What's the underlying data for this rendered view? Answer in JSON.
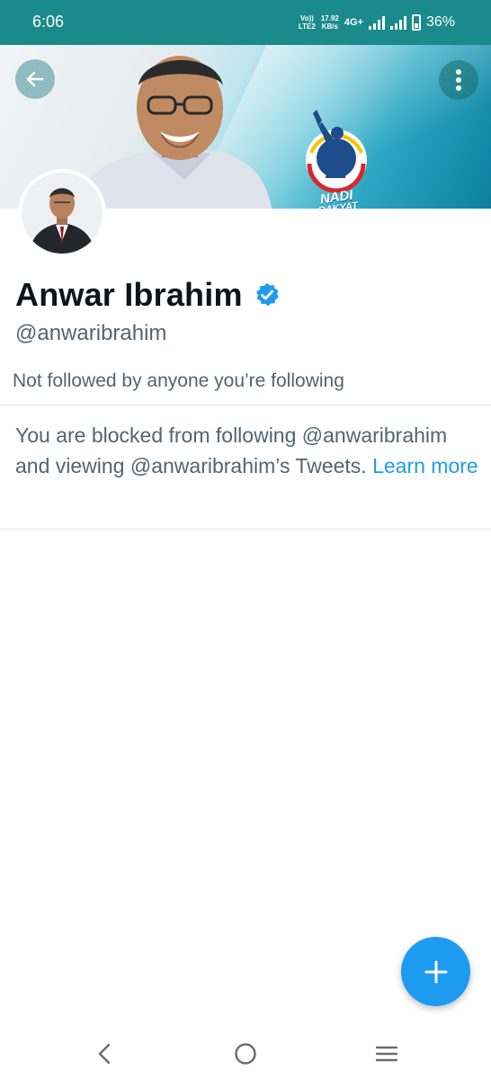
{
  "status_bar": {
    "time": "6:06",
    "volte_top": "Vo))",
    "volte_bottom": "LTE2",
    "speed_value": "17.92",
    "speed_unit": "KB/s",
    "network": "4G+",
    "battery_percent": "36%"
  },
  "banner": {
    "party_logo_line1": "NADI",
    "party_logo_line2": "RAKYAT"
  },
  "profile": {
    "display_name": "Anwar Ibrahim",
    "handle": "@anwaribrahim",
    "followers_note": "Not followed by anyone you’re following",
    "blocked_message": "You are blocked from following @anwaribrahim and viewing @anwaribrahim’s Tweets.",
    "learn_more": "Learn more"
  },
  "icons": {
    "back": "arrow-left-icon",
    "more": "more-vertical-icon",
    "verified": "verified-badge-icon",
    "compose": "plus-icon",
    "nav_back": "chevron-left-icon",
    "nav_home": "circle-home-icon",
    "nav_recents": "menu-lines-icon"
  },
  "colors": {
    "status_bar": "#1b8a8a",
    "accent": "#1d9bf0",
    "secondary_text": "#536471",
    "primary_text": "#0f1419"
  }
}
